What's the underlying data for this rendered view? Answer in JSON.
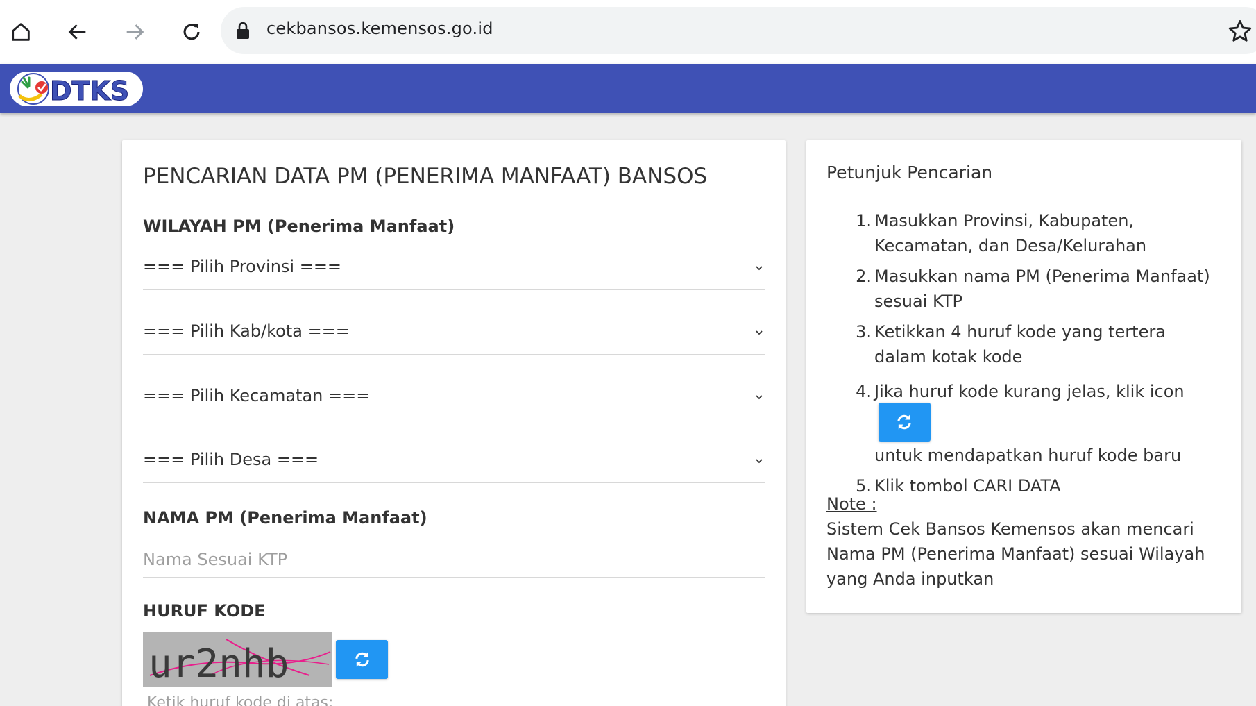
{
  "browser": {
    "url": "cekbansos.kemensos.go.id"
  },
  "header": {
    "logo_text": "DTKS",
    "brand_color": "#3f51b5"
  },
  "form": {
    "title": "PENCARIAN DATA PM (PENERIMA MANFAAT) BANSOS",
    "wilayah_label": "WILAYAH PM (Penerima Manfaat)",
    "selects": [
      {
        "value": "=== Pilih Provinsi ==="
      },
      {
        "value": "=== Pilih Kab/kota ==="
      },
      {
        "value": "=== Pilih Kecamatan ==="
      },
      {
        "value": "=== Pilih Desa ==="
      }
    ],
    "nama_label": "NAMA PM (Penerima Manfaat)",
    "nama_placeholder": "Nama Sesuai KTP",
    "kode_label": "HURUF KODE",
    "captcha_text": "ur2nhb",
    "kode_hint": "Ketik huruf kode di atas:"
  },
  "guide": {
    "title": "Petunjuk Pencarian",
    "steps": [
      {
        "num": "1.",
        "text": "Masukkan Provinsi, Kabupaten, Kecamatan, dan Desa/Kelurahan"
      },
      {
        "num": "2.",
        "text": "Masukkan nama PM (Penerima Manfaat) sesuai KTP"
      },
      {
        "num": "3.",
        "text": "Ketikkan 4 huruf kode yang tertera dalam kotak kode"
      },
      {
        "num": "4.",
        "text_before": "Jika huruf kode kurang jelas, klik icon",
        "text_after": "untuk mendapatkan huruf kode baru"
      },
      {
        "num": "5.",
        "text": "Klik tombol CARI DATA"
      }
    ],
    "note_label": "Note :",
    "note_text": "Sistem Cek Bansos Kemensos akan mencari Nama PM (Penerima Manfaat) sesuai Wilayah yang Anda inputkan"
  },
  "colors": {
    "button_blue": "#2196f3"
  }
}
